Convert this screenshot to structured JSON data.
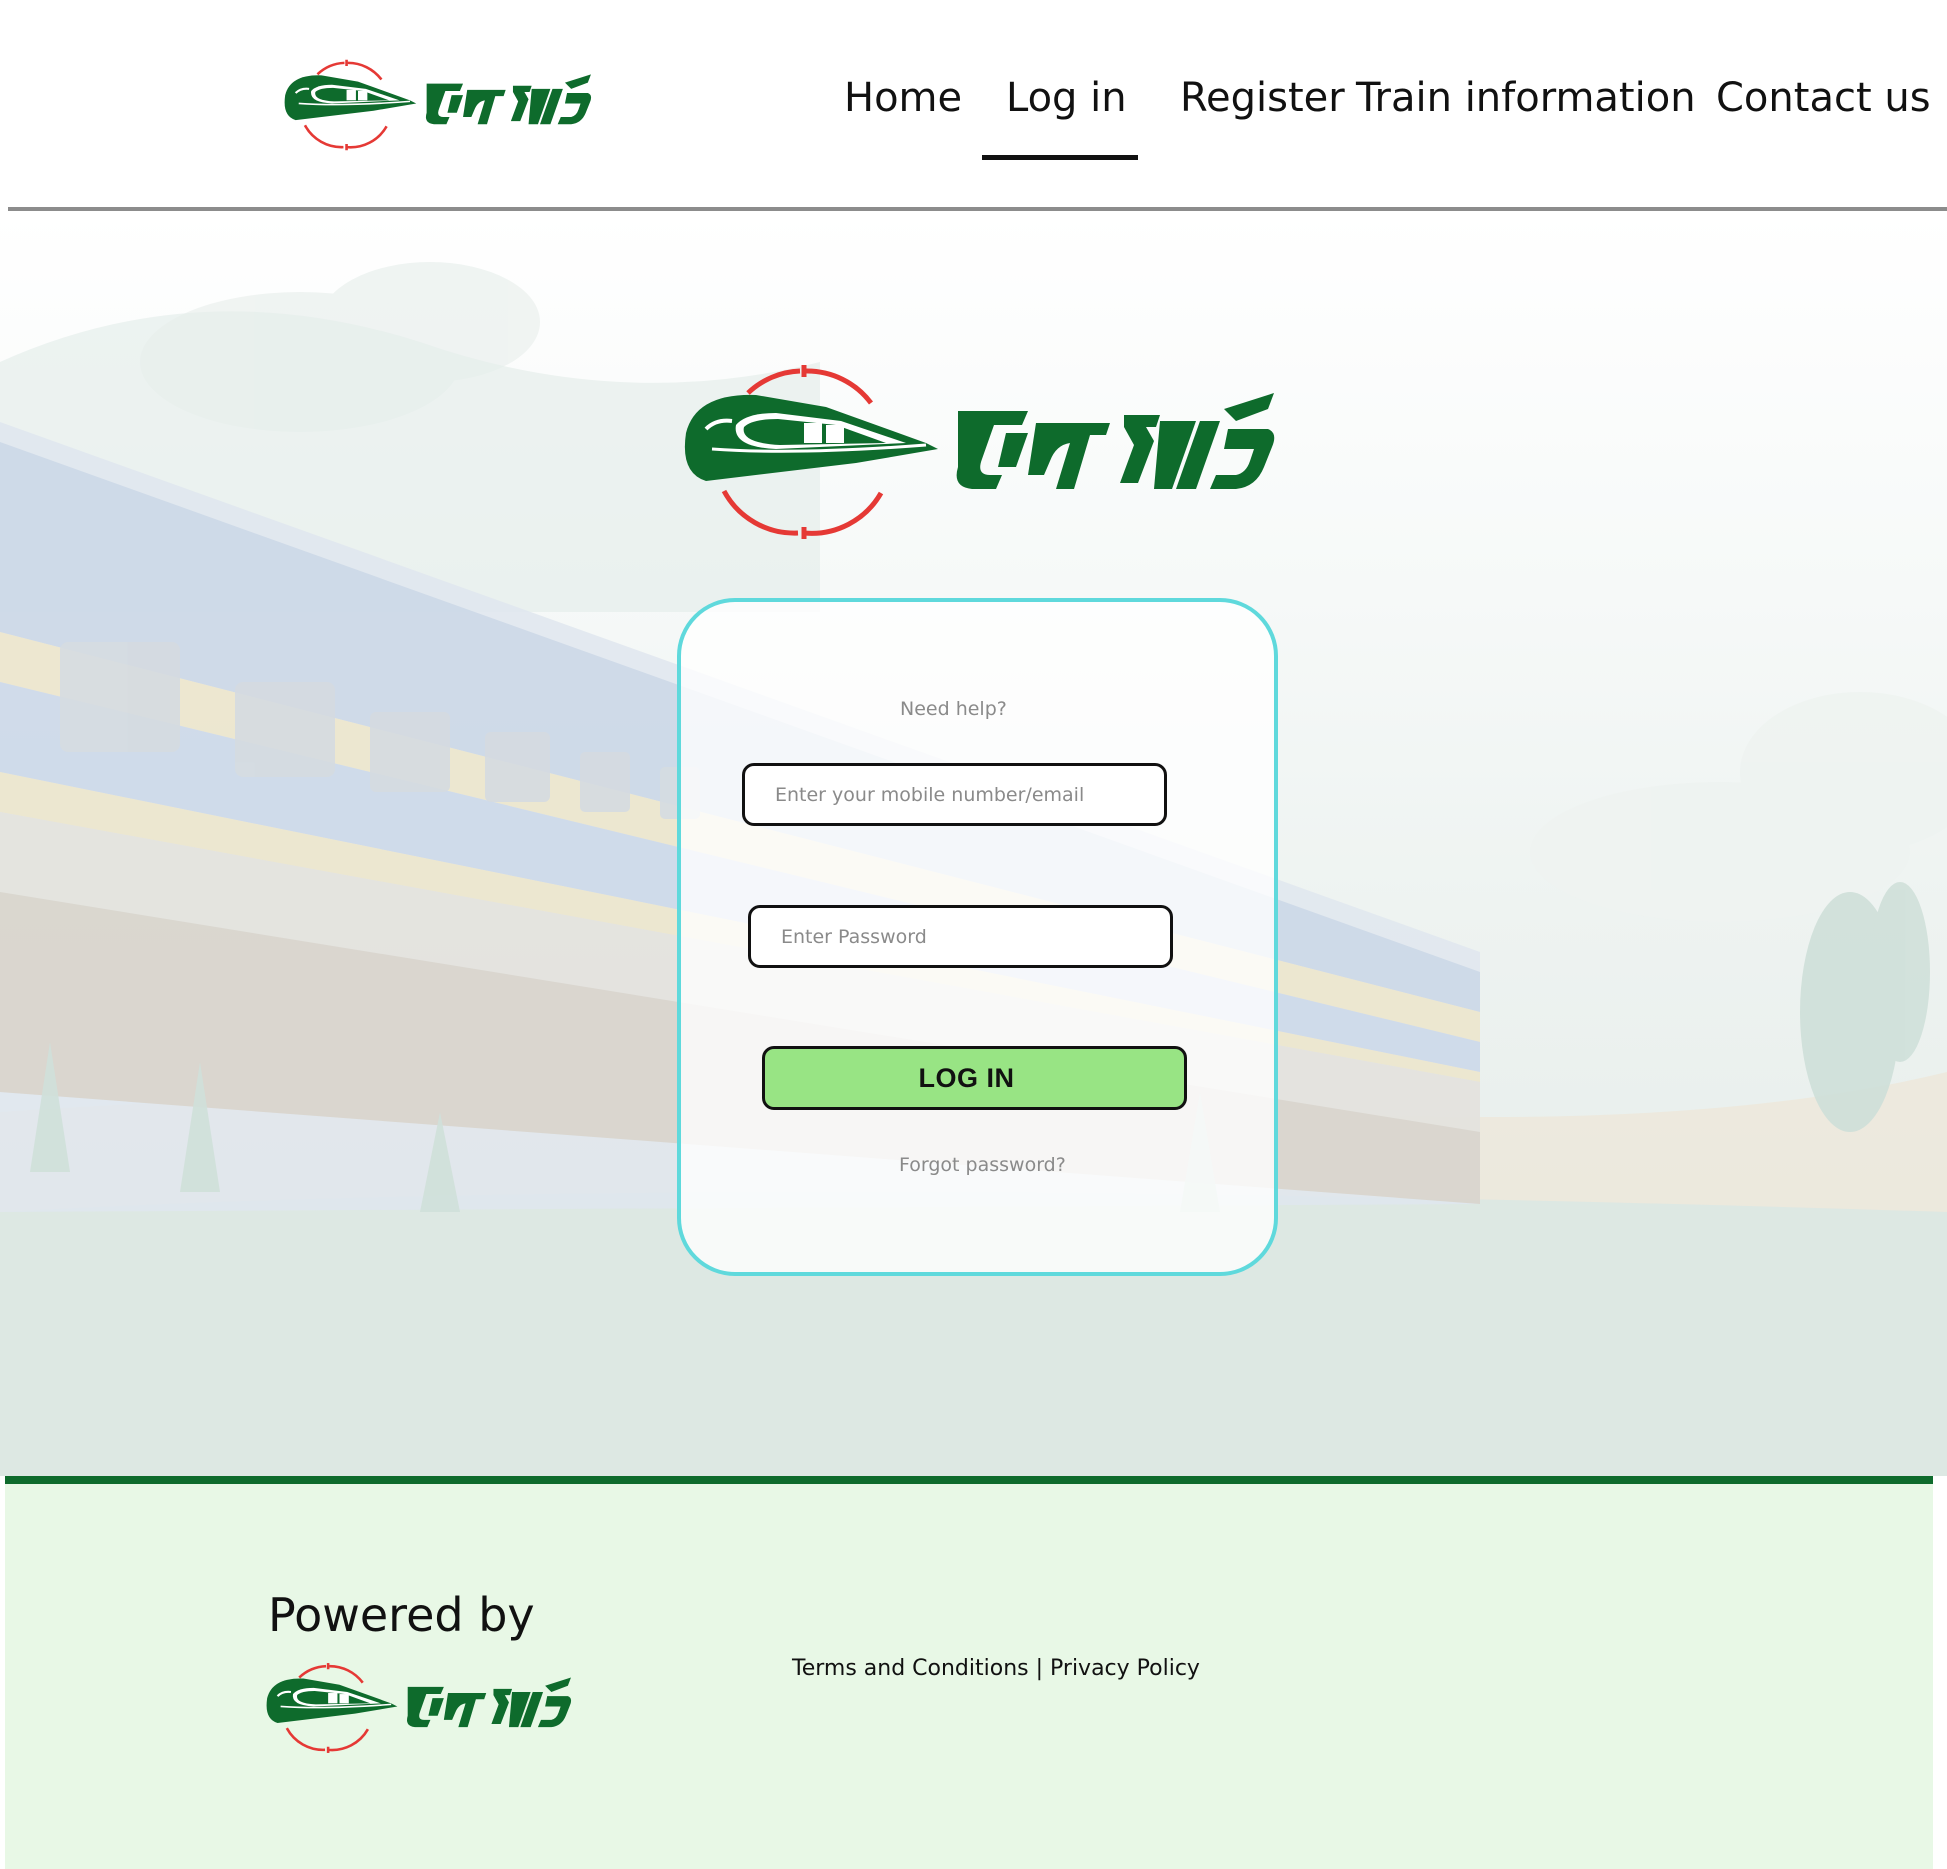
{
  "brand": {
    "logo_text": "চল যাই",
    "colors": {
      "green": "#0e6b2c",
      "red": "#e53935",
      "accent_cyan": "#5fd9dc",
      "button_green": "#98e484",
      "footer_bg": "#e8f8e6"
    }
  },
  "nav": {
    "items": [
      {
        "label": "Home"
      },
      {
        "label": "Log in",
        "active": true
      },
      {
        "label": "Register"
      },
      {
        "label": "Train information"
      },
      {
        "label": "Contact us"
      }
    ]
  },
  "login": {
    "help_text": "Need help?",
    "email_placeholder": "Enter your mobile number/email",
    "password_placeholder": "Enter Password",
    "submit_label": "LOG IN",
    "forgot_text": "Forgot password?"
  },
  "footer": {
    "powered_by": "Powered by",
    "terms": "Terms and Conditions",
    "separator": " | ",
    "privacy": "Privacy Policy"
  },
  "icons": {
    "logo_icon": "train-logo-icon"
  }
}
